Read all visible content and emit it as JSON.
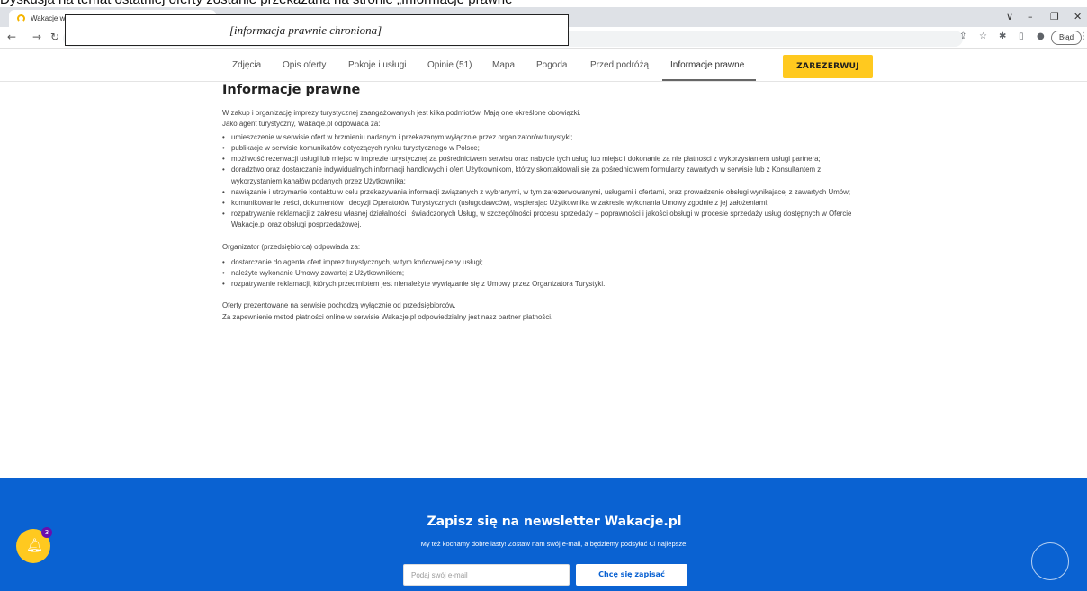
{
  "top_strip": {
    "text": "Dyskusja na temat ostatniej oferty zostanie przekazana na stronie „Informacje prawne”"
  },
  "browser": {
    "tab_title": "Wakacje w",
    "win_controls": {
      "chevron": "∨",
      "minimize": "–",
      "restore": "❐",
      "close": "✕"
    },
    "nav": {
      "back": "←",
      "forward": "→",
      "reload": "↻"
    },
    "toolbar_icons": [
      "share-icon",
      "star-icon",
      "puzzle-icon",
      "sidepanel-icon",
      "profile-icon"
    ],
    "error_label": "Błąd",
    "menu_glyph": "⋮"
  },
  "redaction_note": "[informacja prawnie chroniona]",
  "page_nav": {
    "items": [
      "Zdjęcia",
      "Opis oferty",
      "Pokoje i usługi",
      "Opinie (51)",
      "Mapa",
      "Pogoda",
      "Przed podróżą",
      "Informacje prawne"
    ],
    "active": "Informacje prawne",
    "book_label": "ZAREZERWUJ"
  },
  "legal": {
    "title": "Informacje prawne",
    "intro_1": "W zakup i organizację imprezy turystycznej zaangażowanych jest kilka podmiotów. Mają one określone obowiązki.",
    "intro_2": "Jako agent turystyczny, Wakacje.pl odpowiada za:",
    "agent_duties": [
      "umieszczenie w serwisie ofert w brzmieniu nadanym i przekazanym wyłącznie przez organizatorów turystyki;",
      "publikacje w serwisie komunikatów dotyczących rynku turystycznego w Polsce;",
      "możliwość rezerwacji usługi lub miejsc w imprezie turystycznej za pośrednictwem serwisu oraz nabycie tych usług lub miejsc i dokonanie za nie płatności z wykorzystaniem usługi partnera;",
      "doradztwo oraz dostarczanie indywidualnych informacji handlowych i ofert Użytkownikom, którzy skontaktowali się za pośrednictwem formularzy zawartych w serwisie lub z Konsultantem z wykorzystaniem kanałów podanych przez Użytkownika;",
      "nawiązanie i utrzymanie kontaktu w celu przekazywania informacji związanych z wybranymi, w tym zarezerwowanymi, usługami i ofertami, oraz prowadzenie obsługi wynikającej z zawartych Umów;",
      "komunikowanie treści, dokumentów i decyzji Operatorów Turystycznych (usługodawców), wspierając Użytkownika w zakresie wykonania Umowy zgodnie z jej założeniami;",
      "rozpatrywanie reklamacji z zakresu własnej działalności i świadczonych Usług, w szczególności procesu sprzedaży – poprawności i jakości obsługi w procesie sprzedaży usług dostępnych w Ofercie Wakacje.pl oraz obsługi posprzedażowej."
    ],
    "organizer_intro": "Organizator (przedsiębiorca) odpowiada za:",
    "organizer_duties": [
      "dostarczanie do agenta ofert imprez turystycznych, w tym końcowej ceny usługi;",
      "należyte wykonanie Umowy zawartej z Użytkownikiem;",
      "rozpatrywanie reklamacji, których przedmiotem jest nienależyte wywiązanie się z Umowy przez Organizatora Turystyki."
    ],
    "offers_note": "Oferty prezentowane na serwisie pochodzą wyłącznie od przedsiębiorców.",
    "payment_note": "Za zapewnienie metod płatności online w serwisie Wakacje.pl odpowiedzialny jest nasz partner płatności."
  },
  "newsletter": {
    "title": "Zapisz się na newsletter Wakacje.pl",
    "subtitle": "My też kochamy dobre lasty! Zostaw nam swój e-mail, a będziemy podsyłać Ci najlepsze!",
    "email_value": "",
    "email_placeholder": "Podaj swój e-mail",
    "button_label": "Chcę się zapisać"
  },
  "notifications": {
    "count": "3",
    "icon": "bell-icon"
  },
  "colors": {
    "brand_blue": "#0a62d2",
    "accent_yellow": "#ffc91f"
  }
}
